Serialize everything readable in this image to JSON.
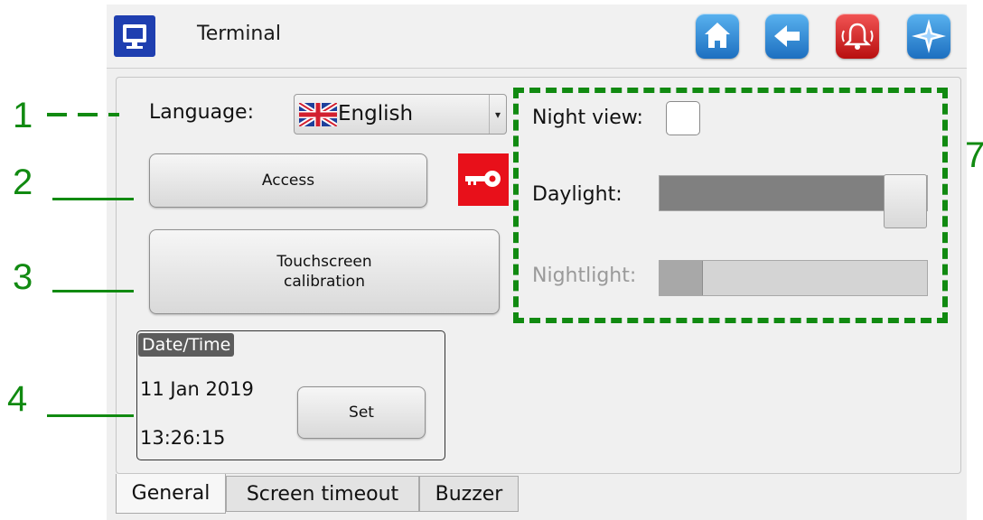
{
  "window": {
    "title": "Terminal"
  },
  "toolbar": {
    "buttons": [
      {
        "icon": "home-icon",
        "color": "#2f8fd8"
      },
      {
        "icon": "back-arrow-icon",
        "color": "#2f8fd8"
      },
      {
        "icon": "alarm-bell-icon",
        "color": "#d91f1f"
      },
      {
        "icon": "compass-icon",
        "color": "#2f8fd8"
      }
    ]
  },
  "general": {
    "language_label": "Language:",
    "language_value": "English",
    "access_label": "Access",
    "calibration_line1": "Touchscreen",
    "calibration_line2": "calibration",
    "datetime": {
      "title": "Date/Time",
      "date": "11 Jan 2019",
      "time": "13:26:15",
      "set_label": "Set"
    },
    "night_view_label": "Night view:",
    "night_view_checked": false,
    "daylight_label": "Daylight:",
    "daylight_level": 1.0,
    "nightlight_label": "Nightlight:",
    "nightlight_level": 0.16,
    "nightlight_enabled": false
  },
  "tabs": [
    {
      "label": "General",
      "active": true
    },
    {
      "label": "Screen timeout",
      "active": false
    },
    {
      "label": "Buzzer",
      "active": false
    }
  ],
  "annotations": {
    "n1": "1",
    "n2": "2",
    "n3": "3",
    "n4": "4",
    "n7": "7",
    "color": "#118a11"
  },
  "colors": {
    "accent_blue": "#2f8fd8",
    "key_red": "#e8101a"
  }
}
